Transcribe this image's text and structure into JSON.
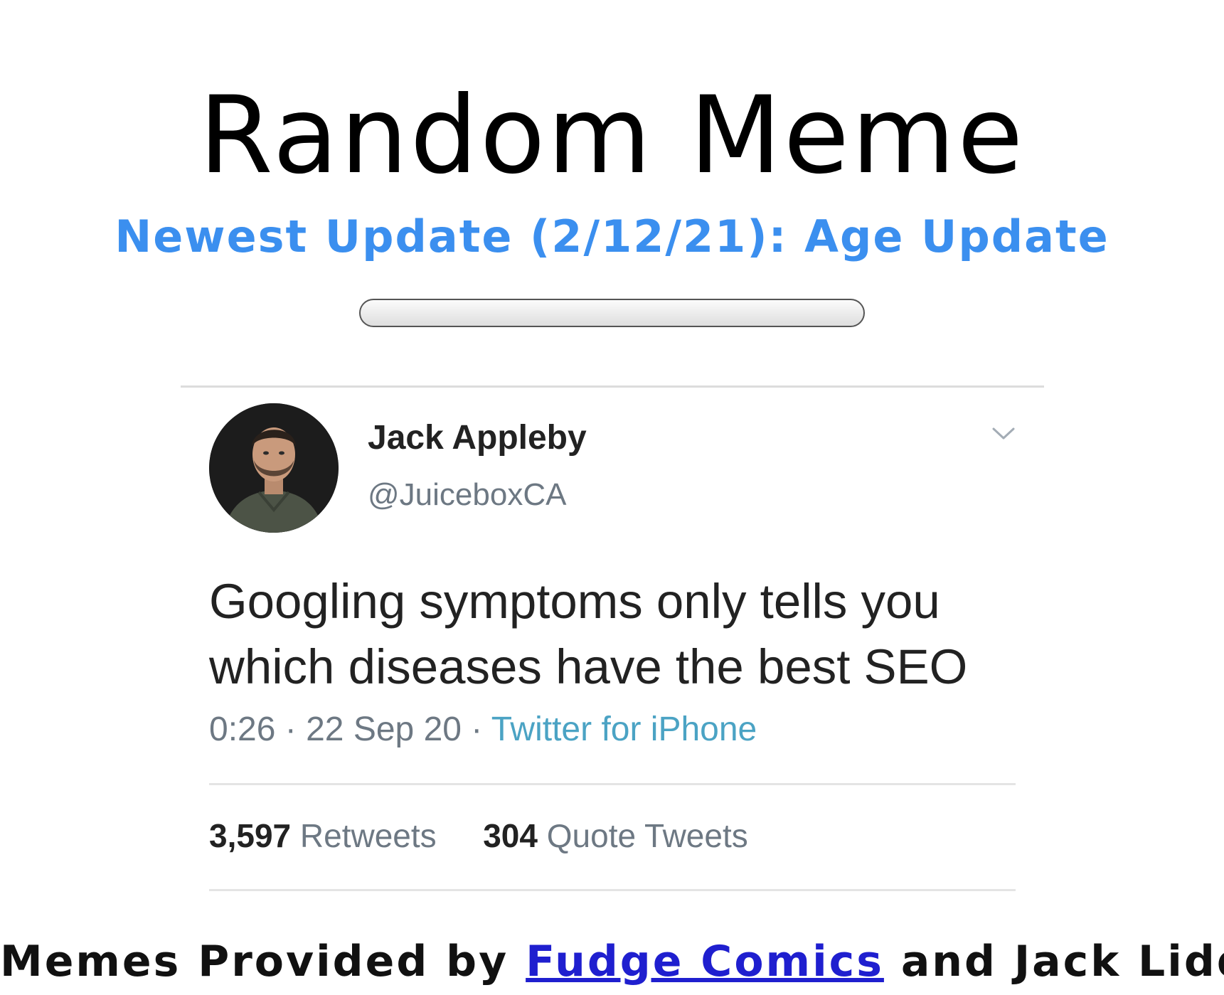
{
  "page": {
    "title": "Random Meme",
    "update_link": "Newest Update (2/12/21): Age Update"
  },
  "meme": {
    "author_name": "Jack Appleby",
    "author_handle": "@JuiceboxCA",
    "text": "Googling symptoms only tells you which diseases have the best SEO",
    "time": "0:26",
    "date": "22 Sep 20",
    "separator": "·",
    "source": "Twitter for iPhone",
    "retweets_count": "3,597",
    "retweets_label": "Retweets",
    "quotes_count": "304",
    "quotes_label": "Quote Tweets"
  },
  "footer": {
    "prefix": "Memes Provided by",
    "link_label": "Fudge Comics",
    "suffix": "and Jack Liddy"
  },
  "colors": {
    "link_blue": "#3b8fef",
    "footer_link": "#1f1fcf",
    "tweet_source": "#4ba3c4"
  },
  "icons": [
    "chevron-down-icon",
    "avatar-photo"
  ]
}
